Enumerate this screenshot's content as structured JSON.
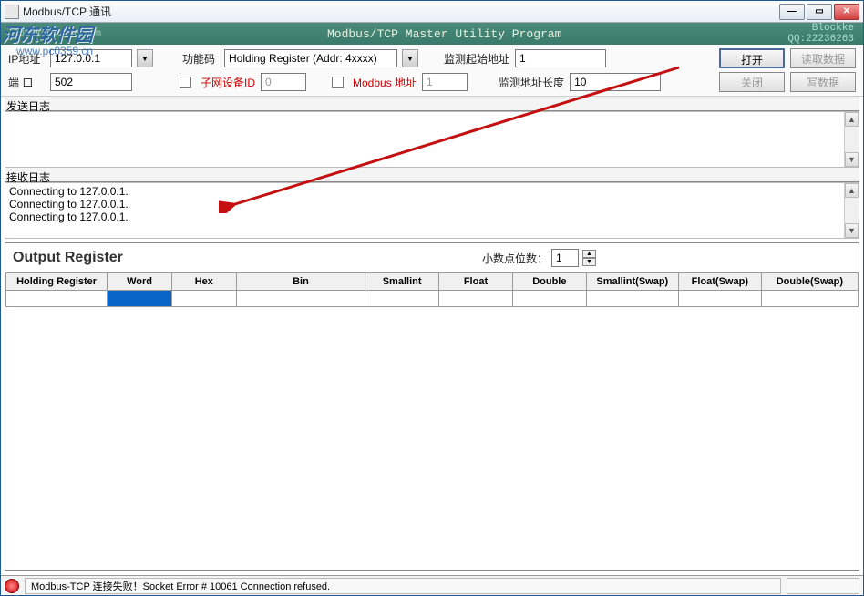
{
  "titlebar": {
    "text": "Modbus/TCP 通讯"
  },
  "header": {
    "sub_left": "lockke.ys168.com",
    "center": "Modbus/TCP   Master Utility Program",
    "right_top": "Blockke",
    "right_bottom": "QQ:22236263"
  },
  "config": {
    "ip_label": "IP地址",
    "ip_value": "127.0.0.1",
    "port_label": "端 口",
    "port_value": "502",
    "func_label": "功能码",
    "func_value": "Holding Register (Addr: 4xxxx)",
    "subnet_id_label": "子网设备ID",
    "subnet_id_value": "0",
    "modbus_addr_label": "Modbus 地址",
    "modbus_addr_value": "1",
    "monitor_start_label": "监测起始地址",
    "monitor_start_value": "1",
    "monitor_len_label": "监测地址长度",
    "monitor_len_value": "10",
    "btn_open": "打开",
    "btn_close": "关闭",
    "btn_read": "读取数据",
    "btn_write": "写数据"
  },
  "logs": {
    "send_label": "发送日志",
    "recv_label": "接收日志",
    "recv_lines": [
      "Connecting to 127.0.0.1.",
      "Connecting to 127.0.0.1.",
      "Connecting to 127.0.0.1."
    ]
  },
  "output": {
    "title": "Output Register",
    "decimal_label": "小数点位数：",
    "decimal_value": "1",
    "columns": [
      "Holding Register",
      "Word",
      "Hex",
      "Bin",
      "Smallint",
      "Float",
      "Double",
      "Smallint(Swap)",
      "Float(Swap)",
      "Double(Swap)"
    ]
  },
  "status": {
    "text": "Modbus-TCP 连接失败！Socket Error # 10061  Connection refused."
  }
}
